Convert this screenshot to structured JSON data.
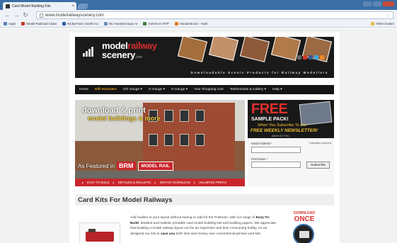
{
  "browser": {
    "tab_title": "Card Model Building Kits",
    "tab_close": "×",
    "url": "www.modelrailwayscenery.com",
    "bookmarks": [
      {
        "label": "Apps",
        "color": "#5a7fb8"
      },
      {
        "label": "Model Railroad Clubs",
        "color": "#c23a2a"
      },
      {
        "label": "NCByTrain | North Ca",
        "color": "#2f5ea6"
      },
      {
        "label": "NC Hosts/Groups At",
        "color": "#6d8fb9"
      },
      {
        "label": "Homes In RTP",
        "color": "#3f7d3c"
      },
      {
        "label": "Harold Brock - Hudl",
        "color": "#e57a20"
      }
    ],
    "other_bookmarks": "Other bookm"
  },
  "site": {
    "logo_word1": "model",
    "logo_word2": "railway",
    "logo_word3": "scenery",
    "logo_tld": ".com",
    "tagline": "Downloadable Scenic Products for Railway Modellers",
    "menu": [
      "Home",
      "Gift Vouchers",
      "OO Gauge ▾",
      "O Gauge ▾",
      "N Gauge ▾",
      "Your Shopping Cart",
      "Testimonials & Gallery ▾",
      "Help ▾"
    ],
    "hero": {
      "line1": "download & print",
      "line2": "model buildings & more",
      "featured": "As Featured in",
      "brm": "BRM",
      "model_rail": "MODEL RAIL",
      "features": [
        "EASY TO BUILD",
        "DETAILED & REALISTIC",
        "INSTANT DOWNLOAD",
        "UNLIMITED PRINTS"
      ]
    },
    "promo": {
      "free": "FREE",
      "sample": "SAMPLE PACK!",
      "subscribe_line": "When You Subscribe To Our",
      "newsletter": "FREE WEEKLY NEWSLETTER!",
      "worth": "(Worth $7 Free)",
      "email_label": "Email Address *",
      "required": "* indicates required",
      "name_label": "First Name *",
      "subscribe_button": "Subscribe"
    },
    "content": {
      "heading": "Card Kits For Model Railways",
      "intro_a": "Add realism to your layout without having to wait for the Postman, with our range of ",
      "intro_bold": "Easy-To-Build",
      "intro_b": ", detailed and realistic printable card model building kits and building papers. We appreciate that building a model railway layout can be an expensive and time consuming hobby, so we designed our kits to ",
      "intro_bold2": "save you",
      "intro_c": " both time and money over conventional printed card kits.",
      "download": "DOWNLOAD",
      "once": "ONCE"
    }
  }
}
